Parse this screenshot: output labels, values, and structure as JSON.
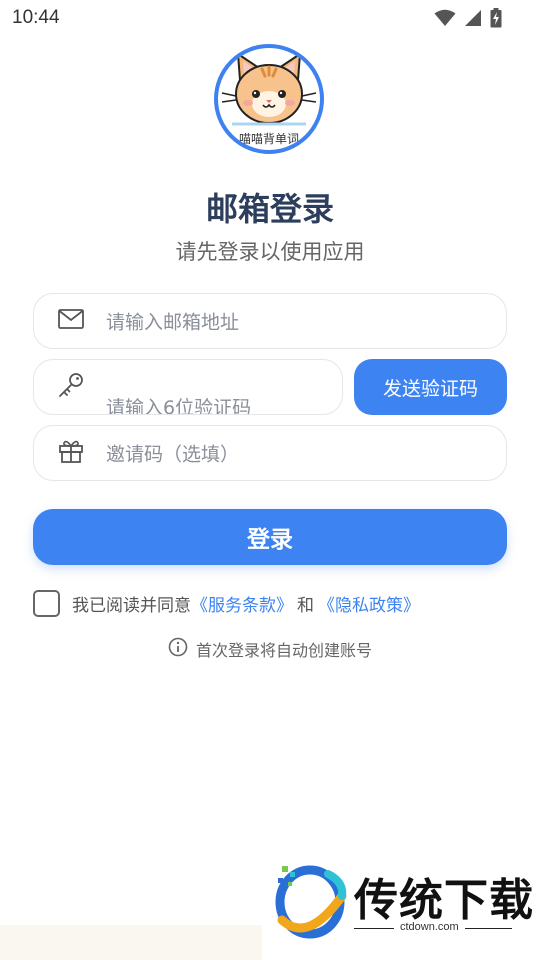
{
  "status_bar": {
    "time": "10:44",
    "icons": [
      "wifi-icon",
      "cellular-signal-icon",
      "battery-charging-icon"
    ]
  },
  "logo": {
    "icon": "cat-face-icon",
    "caption": "喵喵背单词"
  },
  "header": {
    "title": "邮箱登录",
    "subtitle": "请先登录以使用应用"
  },
  "form": {
    "email": {
      "icon": "mail-icon",
      "placeholder": "请输入邮箱地址"
    },
    "code": {
      "icon": "key-icon",
      "placeholder": "请输入6位验证码"
    },
    "invite": {
      "icon": "gift-icon",
      "placeholder": "邀请码（选填）"
    },
    "send_code_label": "发送验证码",
    "login_label": "登录"
  },
  "agreement": {
    "checked": false,
    "prefix": "我已阅读并同意",
    "terms": "《服务条款》",
    "and": "和",
    "privacy": "《隐私政策》"
  },
  "hint": {
    "icon": "info-icon",
    "text": "首次登录将自动创建账号"
  },
  "watermark": {
    "title": "传统下载",
    "url": "ctdown.com"
  },
  "colors": {
    "accent": "#3e83f2",
    "title": "#2c3e5c",
    "border": "#e4e6ea"
  }
}
